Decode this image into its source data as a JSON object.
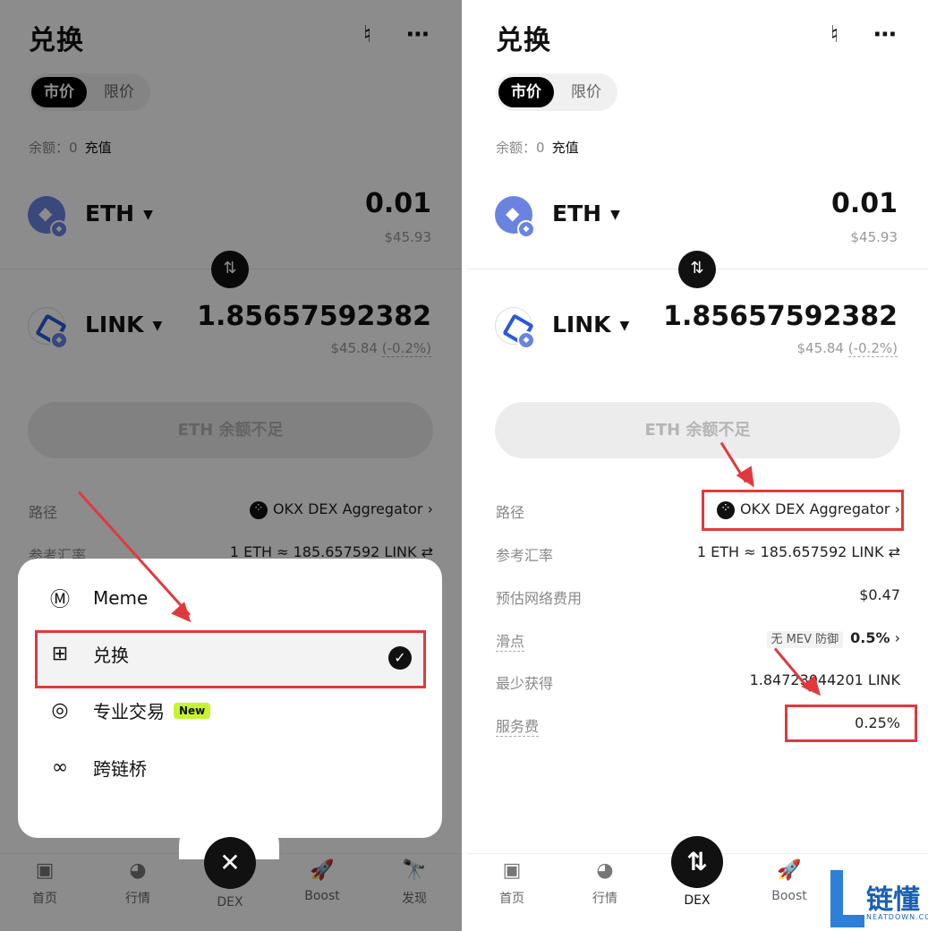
{
  "header": {
    "title": "兑换",
    "chart_icon": "candlestick-icon",
    "more_icon": "ellipsis-icon",
    "more_glyph": "⋯",
    "chart_glyph": "♮"
  },
  "order_tabs": {
    "market": "市价",
    "limit": "限价"
  },
  "balance": {
    "label": "余额：",
    "value": "0",
    "deposit": "充值"
  },
  "from": {
    "token": "ETH",
    "amount": "0.01",
    "usd": "$45.93"
  },
  "to": {
    "token": "LINK",
    "amount": "1.85657592382",
    "usd": "$45.84",
    "change": "(-0.2%)"
  },
  "swap_glyph": "⇅",
  "submit_label": "ETH 余额不足",
  "details": {
    "route_label": "路径",
    "route_value": "OKX DEX Aggregator",
    "chevron": "›",
    "rate_label": "参考汇率",
    "rate_value": "1 ETH ≈ 185.657592 LINK",
    "rate_icon": "⇄",
    "gas_label": "预估网络费用",
    "gas_value": "$0.47",
    "slippage_label": "滑点",
    "mev_badge": "无 MEV 防御",
    "slippage_value": "0.5%",
    "min_label": "最少获得",
    "min_value": "1.84723044201 LINK",
    "fee_label": "服务费",
    "fee_value": "0.25%"
  },
  "menu": {
    "items": [
      {
        "label": "Meme",
        "icon": "meme-icon",
        "glyph": "Ⓜ"
      },
      {
        "label": "兑换",
        "icon": "swap-grid-icon",
        "glyph": "⊞"
      },
      {
        "label": "专业交易",
        "icon": "pro-trade-icon",
        "glyph": "◎",
        "badge": "New"
      },
      {
        "label": "跨链桥",
        "icon": "bridge-icon",
        "glyph": "∞"
      }
    ],
    "check": "✓",
    "close": "✕"
  },
  "tabbar": {
    "items": [
      {
        "label": "首页",
        "icon": "wallet-icon",
        "glyph": "▣"
      },
      {
        "label": "行情",
        "icon": "market-icon",
        "glyph": "◕"
      },
      {
        "label": "DEX",
        "icon": "dex-icon",
        "glyph": "⇅"
      },
      {
        "label": "Boost",
        "icon": "rocket-icon",
        "glyph": "🚀"
      },
      {
        "label": "发现",
        "icon": "telescope-icon",
        "glyph": "🔭"
      }
    ]
  },
  "watermark": {
    "cn": "链懂",
    "en": "NEATDOWN.COM"
  },
  "colors": {
    "accent": "#e0393d",
    "new_badge": "#c6f432",
    "eth": "#6b83e0",
    "link": "#2a5ada"
  }
}
